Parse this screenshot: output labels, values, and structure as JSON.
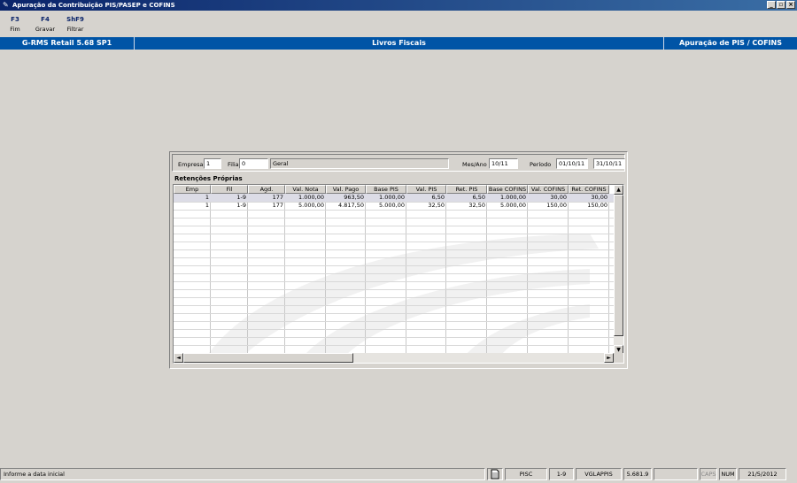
{
  "window": {
    "title": "Apuração da Contribuição PIS/PASEP e COFINS",
    "buttons": {
      "minimize": "_",
      "restore": "▫",
      "close": "×"
    }
  },
  "function_keys": [
    {
      "key": "F3",
      "label": "Fim"
    },
    {
      "key": "F4",
      "label": "Gravar"
    },
    {
      "key": "ShF9",
      "label": "Filtrar"
    }
  ],
  "info_bar": {
    "system": "G-RMS Retail 5.68 SP1",
    "module": "Livros Fiscais",
    "screen": "Apuração de PIS / COFINS"
  },
  "filters": {
    "empresa_label": "Empresa",
    "empresa_value": "1",
    "filial_label": "Filial",
    "filial_value": "0",
    "filial_name": "Geral",
    "mesano_label": "Mes/Ano",
    "mesano_value": "10/11",
    "periodo_label": "Período",
    "periodo_inicio": "01/10/11",
    "periodo_fim": "31/10/11"
  },
  "grid": {
    "title": "Retenções Próprias",
    "columns": [
      "Emp",
      "Fil",
      "Agd.",
      "Val. Nota",
      "Val. Pago",
      "Base PIS",
      "Val. PIS",
      "Ret. PIS",
      "Base COFINS",
      "Val. COFINS",
      "Ret. COFINS"
    ],
    "rows": [
      [
        "1",
        "1-9",
        "177",
        "1.000,00",
        "963,50",
        "1.000,00",
        "6,50",
        "6,50",
        "1.000,00",
        "30,00",
        "30,00"
      ],
      [
        "1",
        "1-9",
        "177",
        "5.000,00",
        "4.817,50",
        "5.000,00",
        "32,50",
        "32,50",
        "5.000,00",
        "150,00",
        "150,00"
      ]
    ],
    "scroll_up": "▲",
    "scroll_down": "▼",
    "scroll_left": "◄",
    "scroll_right": "►"
  },
  "status_bar": {
    "message": "Informe a data inicial",
    "program": "PISC",
    "company": "1-9",
    "user": "VGLAPPIS",
    "version": "5.681.9",
    "caps": "CAPS",
    "num": "NUM",
    "date": "21/5/2012"
  },
  "colors": {
    "title_bar": "#0a246a",
    "info_bar": "#0054a6",
    "background": "#d6d3ce",
    "selected_row": "#dcdce6"
  }
}
